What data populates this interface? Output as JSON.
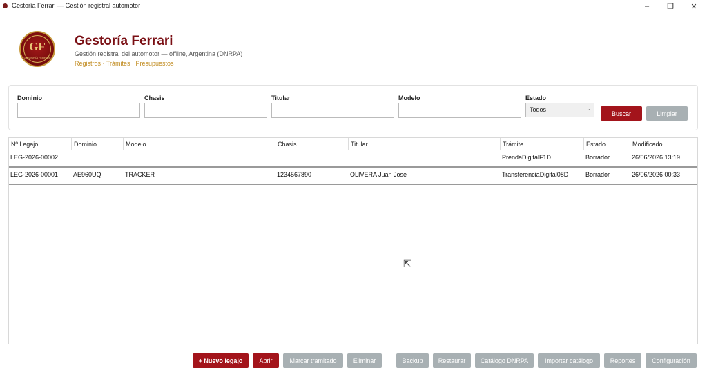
{
  "window": {
    "title": "Gestoría Ferrari — Gestión registral automotor",
    "minimize_glyph": "–",
    "maximize_glyph": "❐",
    "close_glyph": "✕"
  },
  "header": {
    "logo_text": "GF",
    "logo_small": "GESTORÍA FERRARI",
    "title": "Gestoría Ferrari",
    "subtitle": "Gestión registral del automotor — offline, Argentina (DNRPA)",
    "links": "Registros · Trámites · Presupuestos"
  },
  "filters": {
    "dominio_label": "Dominio",
    "dominio_value": "",
    "chasis_label": "Chasis",
    "chasis_value": "",
    "titular_label": "Titular",
    "titular_value": "",
    "modelo_label": "Modelo",
    "modelo_value": "",
    "estado_label": "Estado",
    "estado_value": "Todos",
    "buscar_label": "Buscar",
    "limpiar_label": "Limpiar"
  },
  "table": {
    "columns": [
      "Nº Legajo",
      "Dominio",
      "Modelo",
      "Chasis",
      "Titular",
      "Trámite",
      "Estado",
      "Modificado"
    ],
    "rows": [
      [
        "LEG-2026-00002",
        "",
        "",
        "",
        "",
        "PrendaDigitalF1D",
        "Borrador",
        "26/06/2026 13:19"
      ],
      [
        "LEG-2026-00001",
        "AE960UQ",
        "TRACKER",
        "1234567890",
        "OLIVERA Juan Jose",
        "TransferenciaDigital08D",
        "Borrador",
        "26/06/2026 00:33"
      ]
    ]
  },
  "actions": {
    "nuevo_legajo": "+ Nuevo legajo",
    "abrir": "Abrir",
    "marcar_tramitado": "Marcar tramitado",
    "eliminar": "Eliminar",
    "backup": "Backup",
    "restaurar": "Restaurar",
    "catalogo_dnrpa": "Catálogo DNRPA",
    "importar_catalogo": "Importar catálogo",
    "reportes": "Reportes",
    "configuracion": "Configuración"
  },
  "colors": {
    "brand": "#7a0f14",
    "primary_button": "#a3141b",
    "secondary_button": "#a8b0b3",
    "accent_links": "#c18b1f"
  },
  "icons": {
    "cursor": "mouse-pointer-icon",
    "dropdown": "chevron-down-icon",
    "app": "app-dot-icon"
  }
}
